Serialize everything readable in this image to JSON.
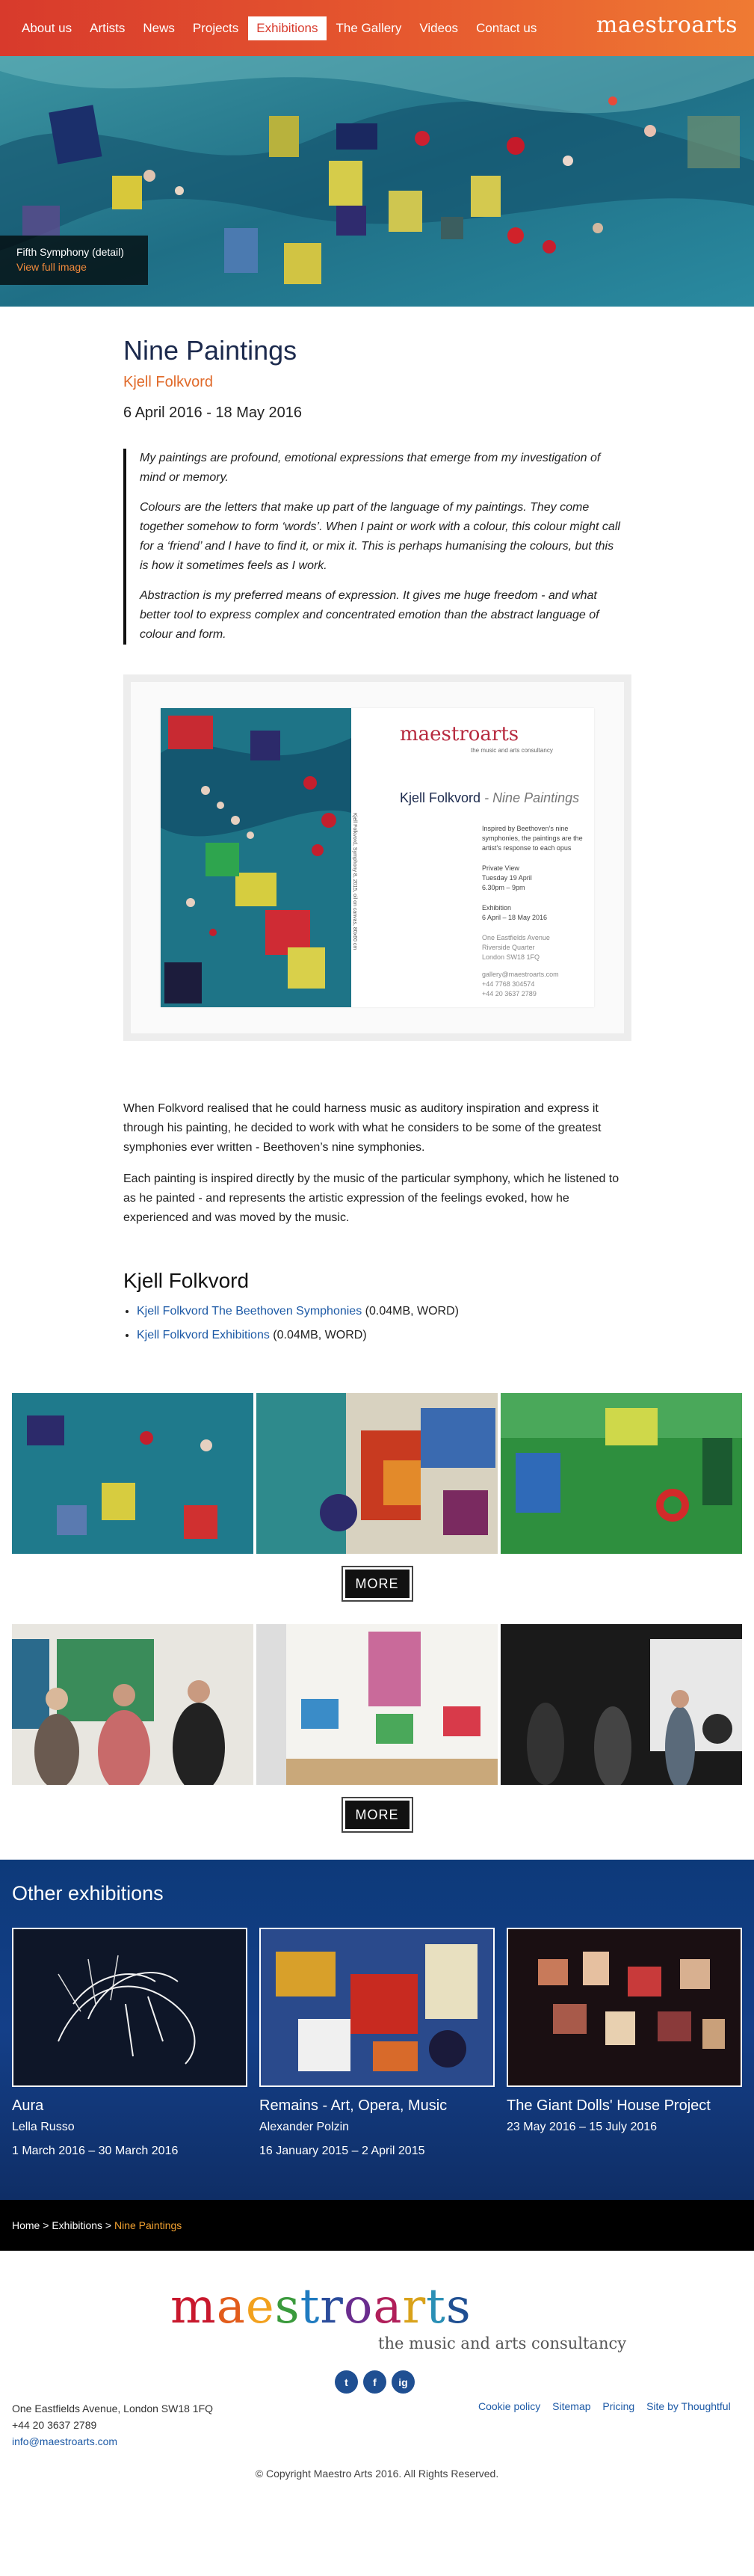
{
  "nav": {
    "items": [
      "About us",
      "Artists",
      "News",
      "Projects",
      "Exhibitions",
      "The Gallery",
      "Videos",
      "Contact us"
    ],
    "active_index": 4,
    "logo": "maestroarts"
  },
  "hero": {
    "caption_title": "Fifth Symphony (detail)",
    "caption_link": "View full image"
  },
  "exhibition": {
    "title": "Nine Paintings",
    "artist": "Kjell Folkvord",
    "dates": "6 April 2016 - 18 May 2016"
  },
  "quote": [
    "My paintings are profound, emotional expressions that emerge from my investigation of mind or memory.",
    "Colours are the letters that make up part of the language of my paintings. They come together somehow to form ‘words’. When I paint or work with a colour, this colour might call for a ‘friend’ and I have to find it, or mix it. This is perhaps humanising the colours, but this is how it sometimes feels as I work.",
    "Abstraction is my preferred means of expression. It gives me huge freedom  - and what better tool to express complex and concentrated emotion than the abstract language of colour and form."
  ],
  "invite": {
    "logo": "maestroarts",
    "logo_tag": "the music and arts consultancy",
    "artist": "Kjell Folkvord",
    "title": "Nine Paintings",
    "side_text": "Kjell Folkvord, Symphony 8, 2015, oil on canvas, 80x60 cm",
    "desc": [
      "Inspired by Beethoven’s nine",
      "symphonies, the paintings are the",
      "artist’s response to each opus"
    ],
    "pv_label": "Private View",
    "pv_day": "Tuesday 19 April",
    "pv_time": "6.30pm – 9pm",
    "ex_label": "Exhibition",
    "ex_dates": "6 April – 18 May 2016",
    "addr": [
      "One Eastfields Avenue",
      "Riverside Quarter",
      "London SW18 1FQ"
    ],
    "contact": [
      "gallery@maestroarts.com",
      "+44 7768 304574",
      "+44 20 3637 2789"
    ]
  },
  "body": [
    "When Folkvord realised that he could harness music as auditory inspiration and express it through his painting, he decided to work with what he considers to be some of the greatest symphonies ever written - Beethoven’s nine symphonies.",
    "Each painting is inspired directly by the music of the particular symphony, which he listened to as he painted - and represents the artistic expression of the feelings evoked, how he experienced and was moved by the music."
  ],
  "downloads": {
    "heading": "Kjell Folkvord",
    "items": [
      {
        "link": "Kjell Folkvord The Beethoven Symphonies",
        "meta": " (0.04MB, WORD)"
      },
      {
        "link": "Kjell Folkvord Exhibitions",
        "meta": " (0.04MB, WORD)"
      }
    ]
  },
  "more_label": "MORE",
  "other": {
    "heading": "Other exhibitions",
    "cards": [
      {
        "title": "Aura",
        "artist": "Lella Russo",
        "dates": "1 March 2016 – 30 March 2016"
      },
      {
        "title": "Remains - Art, Opera, Music",
        "artist": "Alexander Polzin",
        "dates": "16 January 2015 – 2 April 2015"
      },
      {
        "title": "The Giant Dolls' House Project",
        "artist": "",
        "dates": "23 May 2016 – 15 July 2016"
      }
    ]
  },
  "breadcrumb": {
    "home": "Home",
    "sep": " > ",
    "section": "Exhibitions",
    "current": "Nine Paintings"
  },
  "footer": {
    "logo_letters": [
      "m",
      "a",
      "e",
      "s",
      "t",
      "r",
      "o",
      "a",
      "r",
      "t",
      "s"
    ],
    "logo_colors": [
      "#c8182d",
      "#e25c1b",
      "#f2a11e",
      "#3a9a3c",
      "#1f7bc0",
      "#2a4c9b",
      "#6a2d8e",
      "#b01f5a",
      "#d9a21a",
      "#2a8fb5",
      "#1f4f92"
    ],
    "tagline": "the music and arts consultancy",
    "social": [
      "t",
      "f",
      "ig"
    ],
    "address": "One Eastfields Avenue, London SW18 1FQ",
    "phone": "+44 20 3637 2789",
    "email": "info@maestroarts.com",
    "links": [
      "Cookie policy",
      "Sitemap",
      "Pricing",
      "Site by Thoughtful"
    ],
    "copyright": "© Copyright Maestro Arts 2016. All Rights Reserved."
  }
}
